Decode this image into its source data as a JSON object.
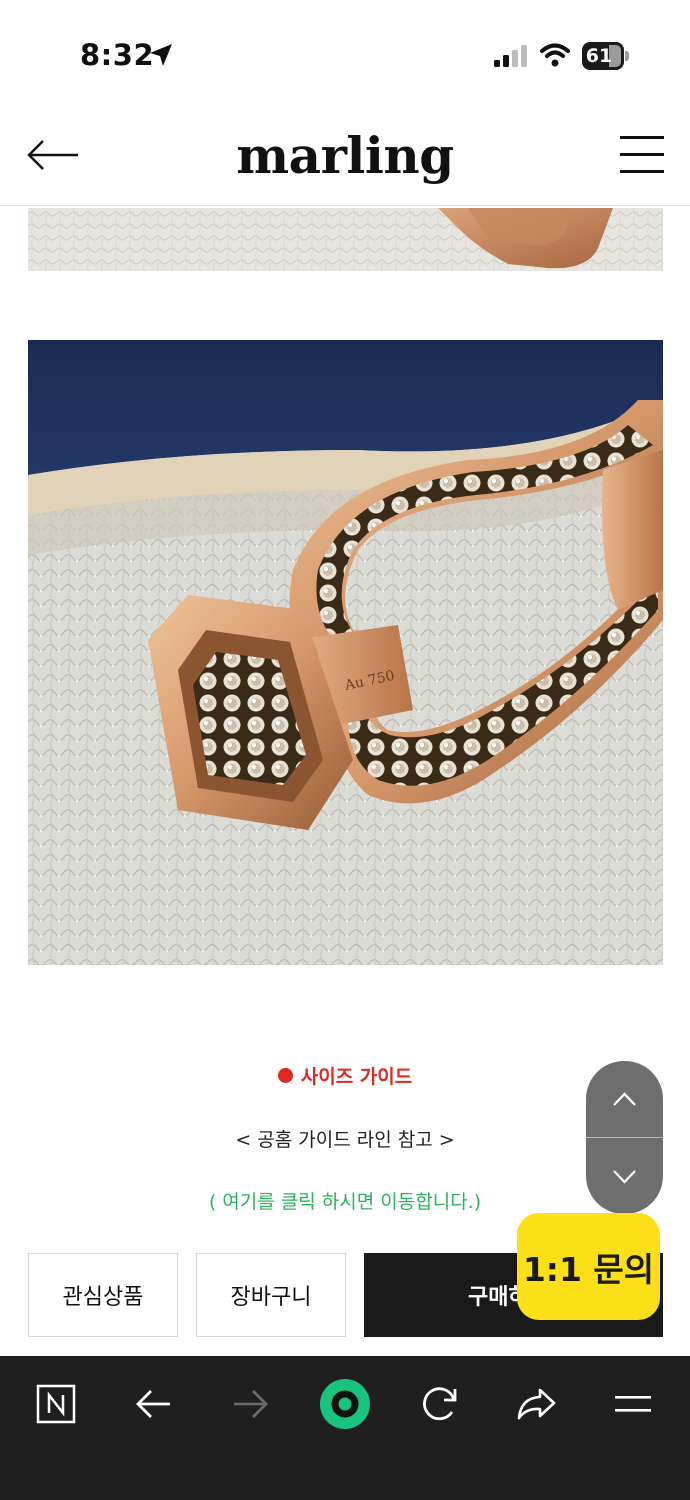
{
  "status_bar": {
    "time": "8:32",
    "battery": "61"
  },
  "header": {
    "logo": "marling"
  },
  "size_guide": {
    "title": "사이즈 가이드",
    "guide_line": "< 공홈 가이드 라인 참고 >",
    "link_text": "( 여기를 클릭 하시면 이동합니다.)"
  },
  "actions": {
    "wishlist_label": "관심상품",
    "cart_label": "장바구니",
    "buy_label": "구매하기",
    "chat_label": "1:1 문의"
  },
  "colors": {
    "accent_red": "#e0281f",
    "link_green": "#2bb35a",
    "chat_yellow": "#fbe019",
    "buy_black": "#1a1a1a",
    "browser_green": "#19c37d"
  },
  "icons": {
    "header": [
      "back-arrow-icon",
      "hamburger-menu-icon"
    ],
    "browser_toolbar": [
      "naver-n-icon",
      "back-icon",
      "forward-icon",
      "green-home-icon",
      "reload-icon",
      "share-icon",
      "menu-icon"
    ]
  }
}
